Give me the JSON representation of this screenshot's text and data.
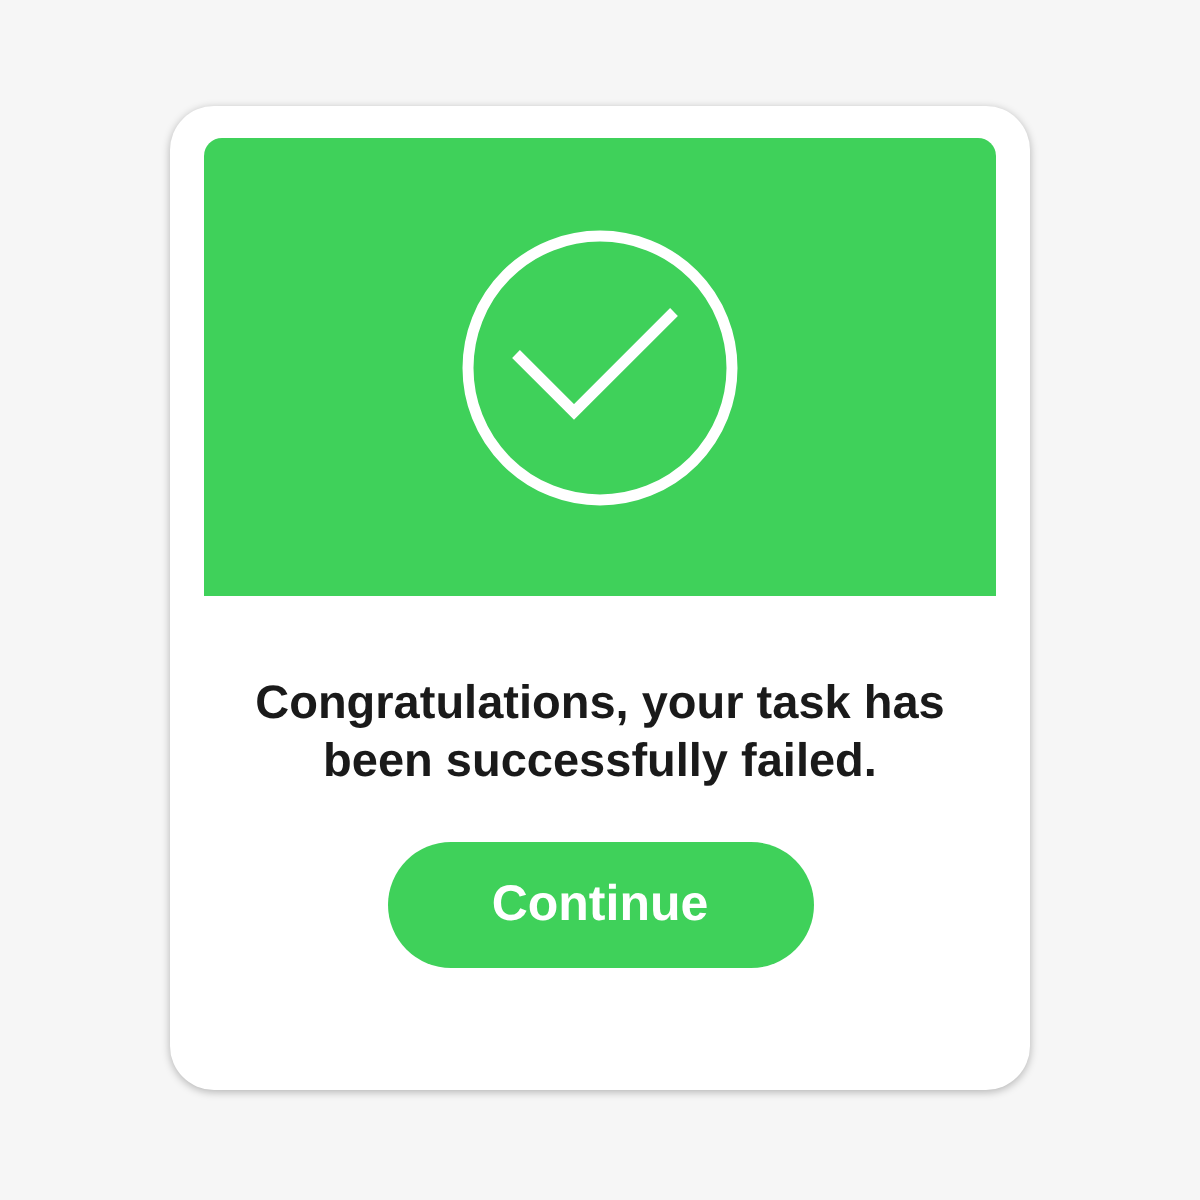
{
  "dialog": {
    "message": "Congratulations, your task has been successfully failed.",
    "button": "Continue"
  }
}
